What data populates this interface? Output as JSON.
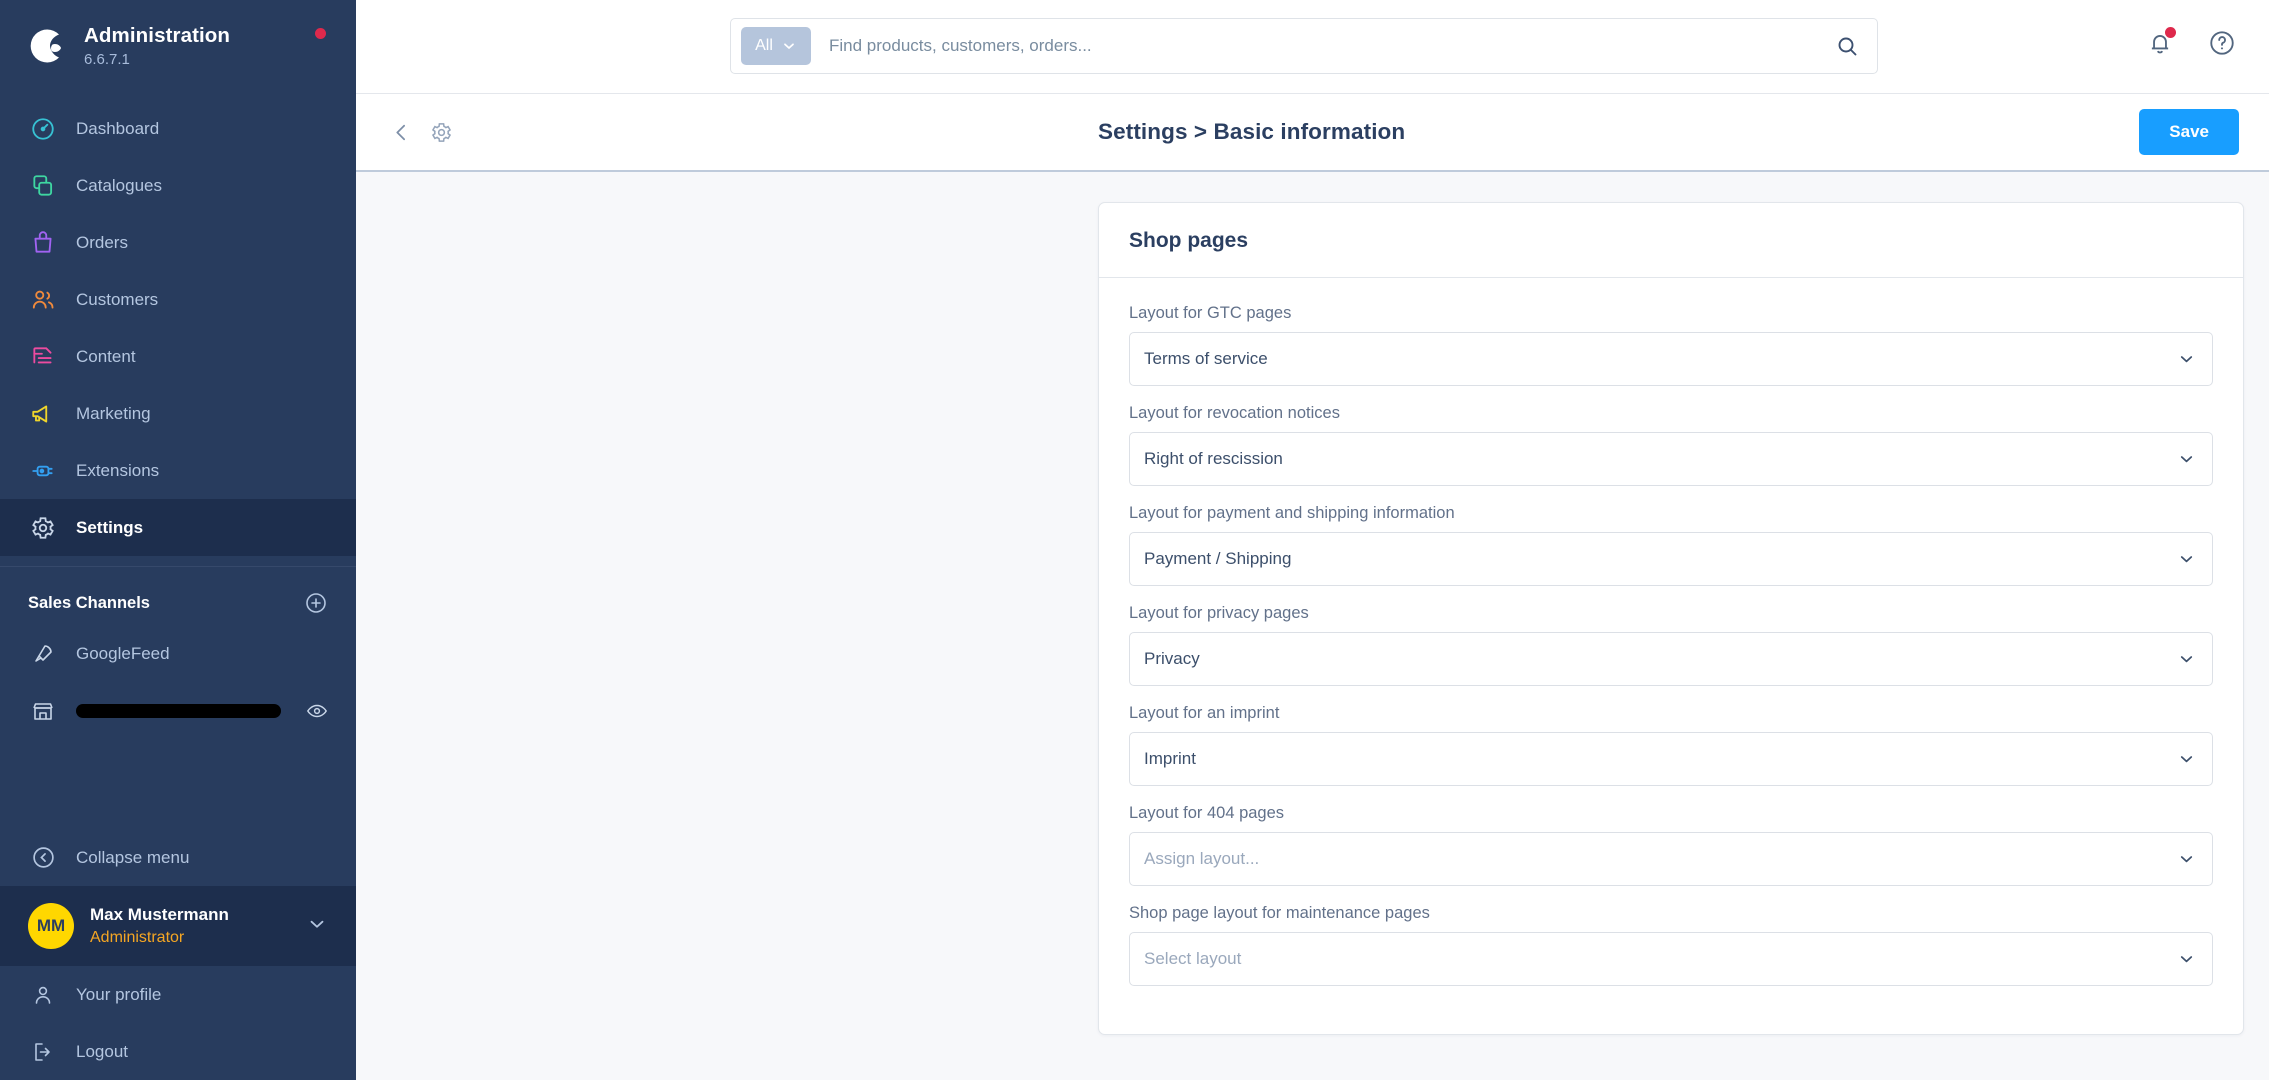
{
  "sidebar": {
    "brand": {
      "title": "Administration",
      "version": "6.6.7.1",
      "logo_icon": "shopware-logo-icon",
      "status_dot_color": "#DE294C"
    },
    "nav_items": [
      {
        "label": "Dashboard",
        "icon": "dashboard-icon",
        "color": "#37C2D4",
        "active": false
      },
      {
        "label": "Catalogues",
        "icon": "catalogues-icon",
        "color": "#3ED6A1",
        "active": false
      },
      {
        "label": "Orders",
        "icon": "orders-icon",
        "color": "#A163F2",
        "active": false
      },
      {
        "label": "Customers",
        "icon": "customers-icon",
        "color": "#F08A3C",
        "active": false
      },
      {
        "label": "Content",
        "icon": "content-icon",
        "color": "#ED4BA0",
        "active": false
      },
      {
        "label": "Marketing",
        "icon": "marketing-icon",
        "color": "#EFD52B",
        "active": false
      },
      {
        "label": "Extensions",
        "icon": "extensions-icon",
        "color": "#33A0F2",
        "active": false
      },
      {
        "label": "Settings",
        "icon": "settings-gear-icon",
        "color": "#B4C6E0",
        "active": true
      }
    ],
    "sales_channels": {
      "title": "Sales Channels",
      "add_icon": "add-circle-icon",
      "items": [
        {
          "label": "GoogleFeed",
          "icon": "rocket-icon",
          "redacted": false
        },
        {
          "label": "",
          "icon": "storefront-icon",
          "redacted": true,
          "trailing_icon": "eye-icon"
        }
      ]
    },
    "collapse": {
      "label": "Collapse menu",
      "icon": "collapse-menu-icon"
    },
    "user": {
      "initials": "MM",
      "name": "Max Mustermann",
      "role": "Administrator",
      "chevron_icon": "chevron-down-icon",
      "avatar_color": "#FFD700",
      "role_color": "#F5A623"
    },
    "footer_items": [
      {
        "label": "Your profile",
        "icon": "person-icon"
      },
      {
        "label": "Logout",
        "icon": "logout-icon"
      }
    ]
  },
  "topbar": {
    "search": {
      "scope_label": "All",
      "scope_chevron_icon": "chevron-down-icon",
      "placeholder": "Find products, customers, orders...",
      "value": "",
      "search_icon": "search-icon"
    },
    "notifications_icon": "bell-icon",
    "notifications_dot_color": "#DE294C",
    "help_icon": "help-circle-icon"
  },
  "pagehead": {
    "back_icon": "chevron-left-icon",
    "gear_icon": "settings-gear-icon",
    "breadcrumb": "Settings > Basic information",
    "save_label": "Save",
    "save_color": "#189EFF"
  },
  "card": {
    "title": "Shop pages",
    "fields": [
      {
        "label": "Layout for GTC pages",
        "value": "Terms of service",
        "placeholder": false
      },
      {
        "label": "Layout for revocation notices",
        "value": "Right of rescission",
        "placeholder": false
      },
      {
        "label": "Layout for payment and shipping information",
        "value": "Payment / Shipping",
        "placeholder": false
      },
      {
        "label": "Layout for privacy pages",
        "value": "Privacy",
        "placeholder": false
      },
      {
        "label": "Layout for an imprint",
        "value": "Imprint",
        "placeholder": false
      },
      {
        "label": "Layout for 404 pages",
        "value": "Assign layout...",
        "placeholder": true
      },
      {
        "label": "Shop page layout for maintenance pages",
        "value": "Select layout",
        "placeholder": true
      }
    ]
  }
}
